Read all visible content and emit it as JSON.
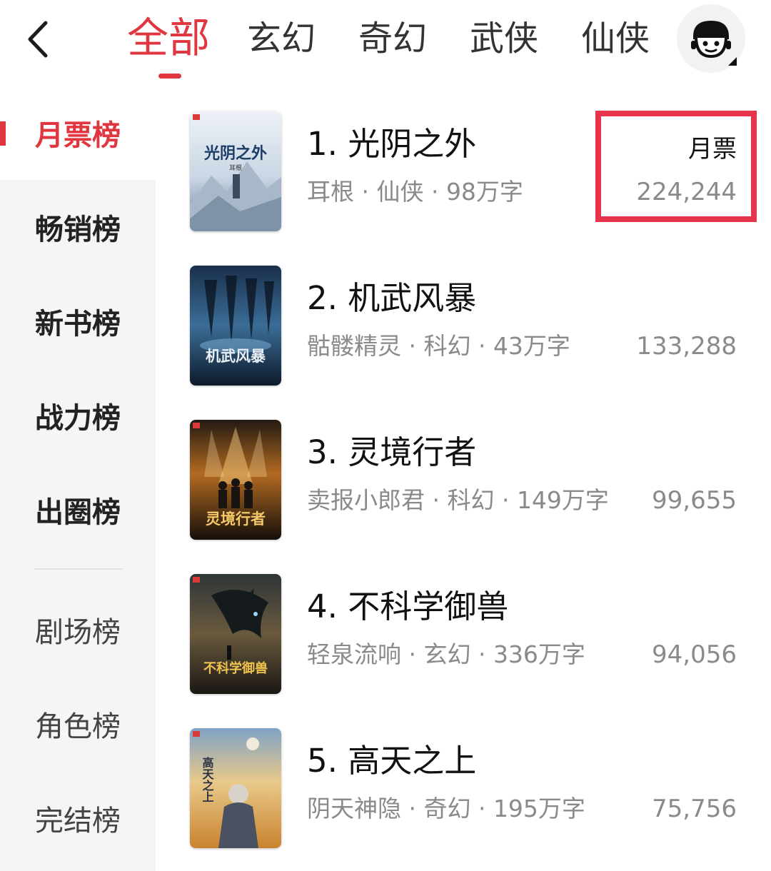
{
  "colors": {
    "accent": "#e0363f",
    "highlight_box": "#e8344a",
    "meta_text": "#8a8a8a"
  },
  "header": {
    "back_icon": "chevron-left-icon",
    "tabs": [
      {
        "label": "全部",
        "active": true
      },
      {
        "label": "玄幻",
        "active": false
      },
      {
        "label": "奇幻",
        "active": false
      },
      {
        "label": "武侠",
        "active": false
      },
      {
        "label": "仙侠",
        "active": false
      }
    ],
    "avatar_icon": "avatar-face-icon"
  },
  "sidebar": {
    "items": [
      {
        "label": "月票榜",
        "active": true
      },
      {
        "label": "畅销榜",
        "active": false
      },
      {
        "label": "新书榜",
        "active": false
      },
      {
        "label": "战力榜",
        "active": false
      },
      {
        "label": "出圈榜",
        "active": false
      },
      {
        "label": "剧场榜",
        "active": false
      },
      {
        "label": "角色榜",
        "active": false
      },
      {
        "label": "完结榜",
        "active": false
      }
    ]
  },
  "list": {
    "vote_label": "月票",
    "books": [
      {
        "rank_title": "1. 光阴之外",
        "meta": "耳根 · 仙侠 · 98万字",
        "votes": "224,244",
        "cover_text": "光阴之外",
        "cover_author": "耳根"
      },
      {
        "rank_title": "2. 机武风暴",
        "meta": "骷髅精灵 · 科幻 · 43万字",
        "votes": "133,288",
        "cover_text": "机武风暴"
      },
      {
        "rank_title": "3. 灵境行者",
        "meta": "卖报小郎君 · 科幻 · 149万字",
        "votes": "99,655",
        "cover_text": "灵境行者"
      },
      {
        "rank_title": "4. 不科学御兽",
        "meta": "轻泉流响 · 玄幻 · 336万字",
        "votes": "94,056",
        "cover_text": "不科学御兽"
      },
      {
        "rank_title": "5. 高天之上",
        "meta": "阴天神隐 · 奇幻 · 195万字",
        "votes": "75,756",
        "cover_text": "高天之上"
      }
    ]
  }
}
